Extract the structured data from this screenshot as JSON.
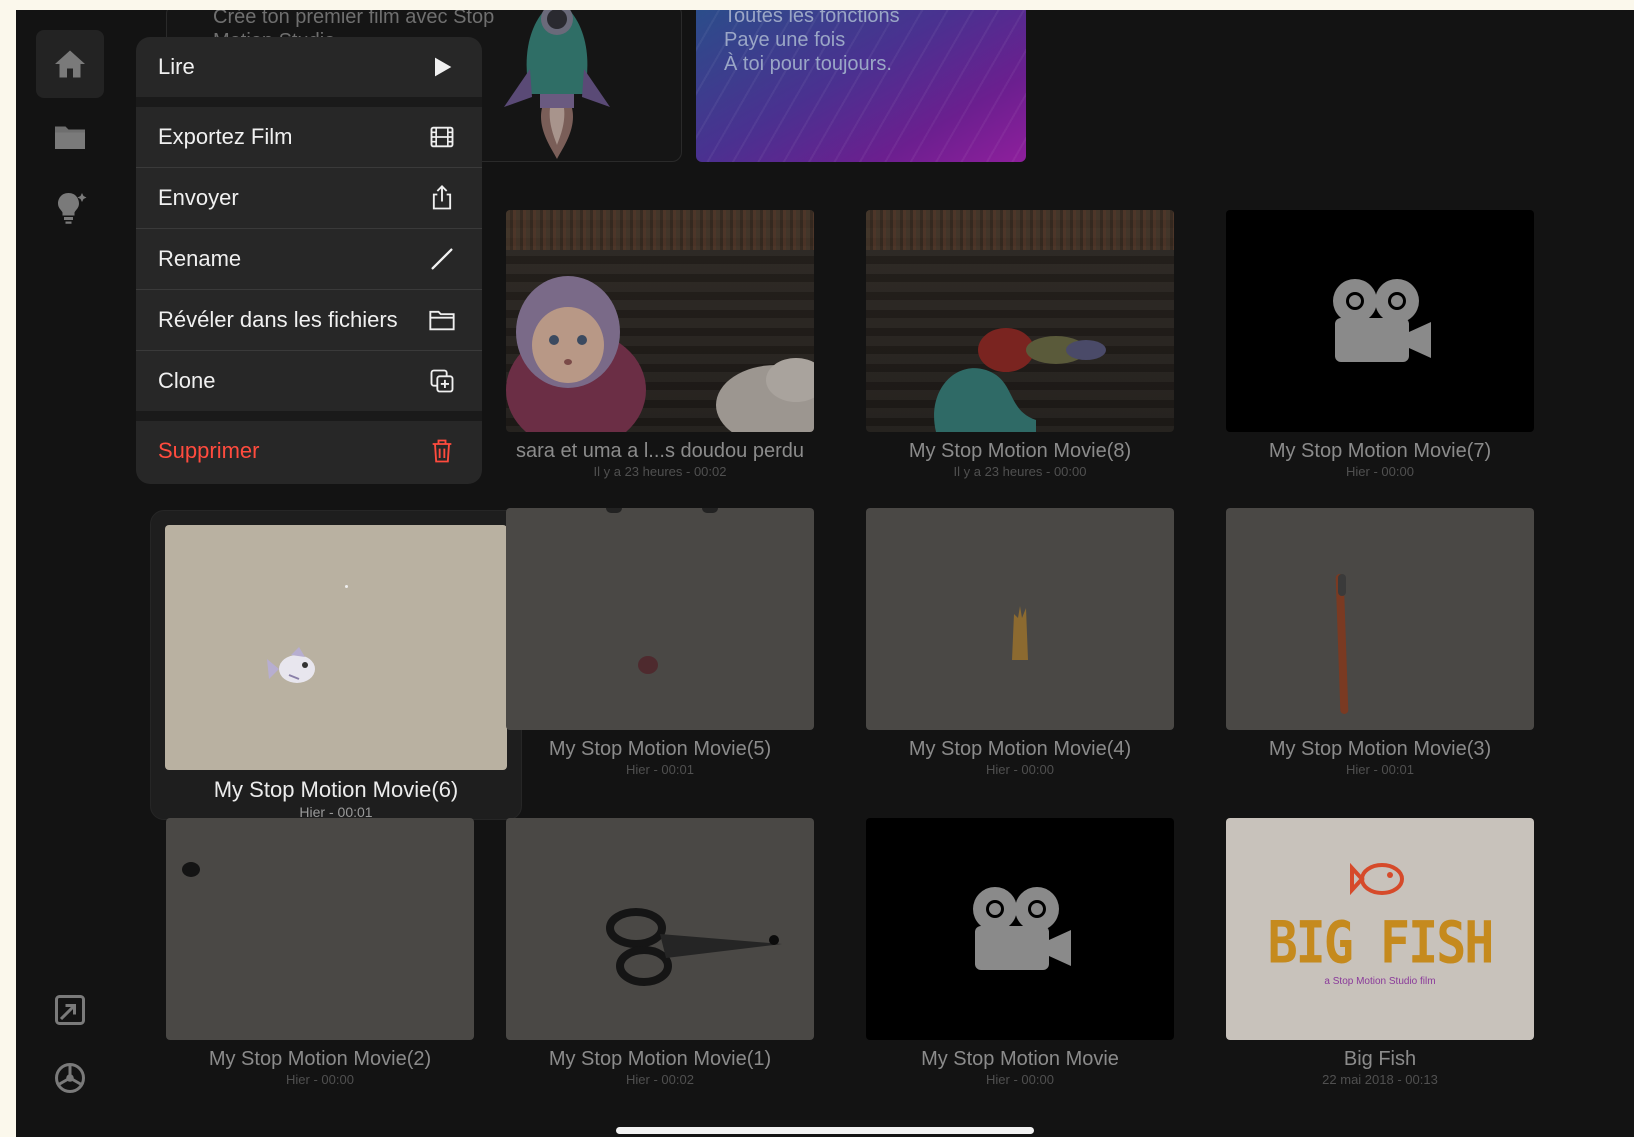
{
  "banners": {
    "left_lines": [
      "Crée ton premier film avec Stop",
      "Motion Studio"
    ],
    "right_lines": [
      "Toutes les fonctions",
      "Paye une fois",
      "À toi pour toujours."
    ]
  },
  "sidebar": {
    "items": [
      {
        "icon": "home-icon",
        "active": true
      },
      {
        "icon": "folder-icon",
        "active": false
      },
      {
        "icon": "lightbulb-icon",
        "active": false
      }
    ],
    "bottom": [
      {
        "icon": "screen-mirror-icon"
      },
      {
        "icon": "settings-icon"
      }
    ]
  },
  "menu": {
    "play": "Lire",
    "export": "Exportez Film",
    "send": "Envoyer",
    "rename": "Rename",
    "reveal": "Révéler dans les fichiers",
    "clone": "Clone",
    "delete": "Supprimer"
  },
  "movies": [
    {
      "title": "sara et uma a l...s doudou perdu",
      "meta": "Il y a 23 heures - 00:02"
    },
    {
      "title": "My Stop Motion Movie(8)",
      "meta": "Il y a 23 heures - 00:00"
    },
    {
      "title": "My Stop Motion Movie(7)",
      "meta": "Hier - 00:00"
    },
    {
      "title": "My Stop Motion Movie(6)",
      "meta": "Hier - 00:01"
    },
    {
      "title": "My Stop Motion Movie(5)",
      "meta": "Hier - 00:01"
    },
    {
      "title": "My Stop Motion Movie(4)",
      "meta": "Hier - 00:00"
    },
    {
      "title": "My Stop Motion Movie(3)",
      "meta": "Hier - 00:01"
    },
    {
      "title": "My Stop Motion Movie(2)",
      "meta": "Hier - 00:00"
    },
    {
      "title": "My Stop Motion Movie(1)",
      "meta": "Hier - 00:02"
    },
    {
      "title": "My Stop Motion Movie",
      "meta": "Hier - 00:00"
    },
    {
      "title": "Big Fish",
      "meta": "22 mai 2018 - 00:13"
    }
  ],
  "bigfish": {
    "title_text": "BIG FISH",
    "subtitle": "a Stop Motion Studio film"
  },
  "colors": {
    "delete": "#ff4b3e",
    "accent_purple": "#8e1f9c",
    "bigfish_title": "#e29a1e"
  }
}
